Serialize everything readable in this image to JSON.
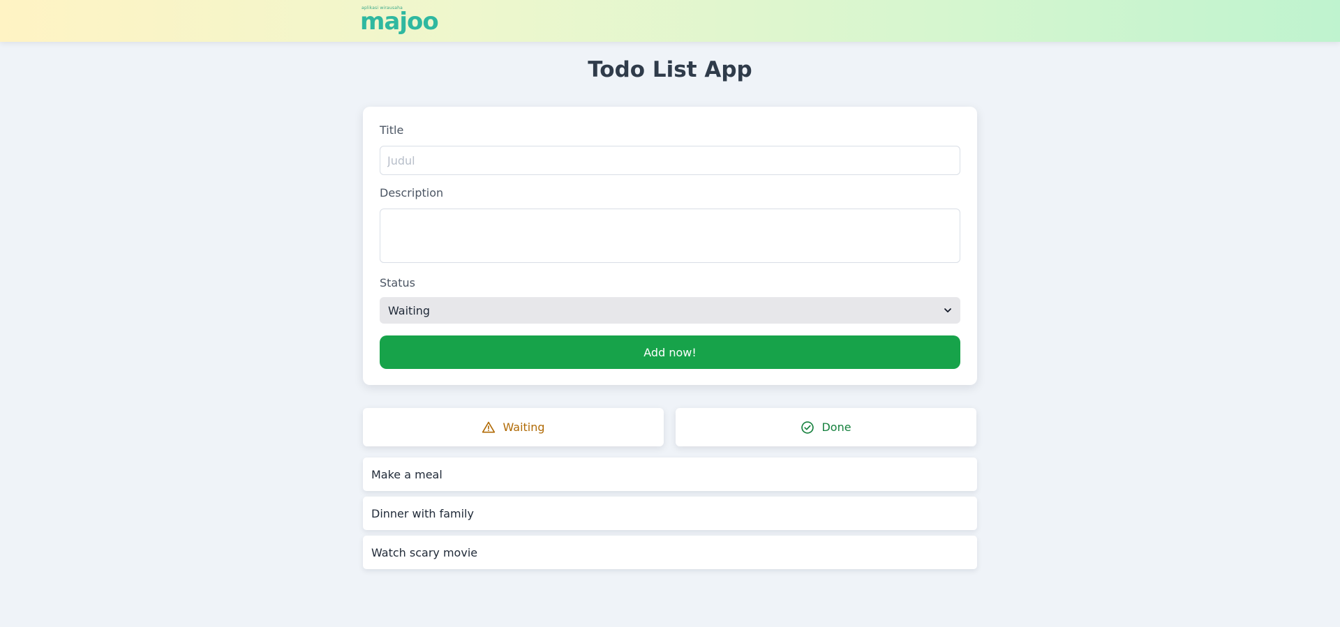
{
  "header": {
    "logo_tagline": "aplikasi wirausaha",
    "logo_text": "majoo"
  },
  "page": {
    "title": "Todo List App"
  },
  "form": {
    "title_label": "Title",
    "title_placeholder": "Judul",
    "title_value": "",
    "description_label": "Description",
    "description_value": "",
    "status_label": "Status",
    "status_value": "Waiting",
    "submit_label": "Add now!"
  },
  "tabs": [
    {
      "label": "Waiting",
      "icon": "warning-triangle-icon",
      "color": "#b06a05"
    },
    {
      "label": "Done",
      "icon": "check-circle-icon",
      "color": "#15803d"
    }
  ],
  "todos": [
    {
      "title": "Make a meal"
    },
    {
      "title": "Dinner with family"
    },
    {
      "title": "Watch scary movie"
    }
  ],
  "colors": {
    "accent_green": "#17a34a",
    "background": "#eff3f8",
    "logo_teal": "#2fb8a0"
  }
}
